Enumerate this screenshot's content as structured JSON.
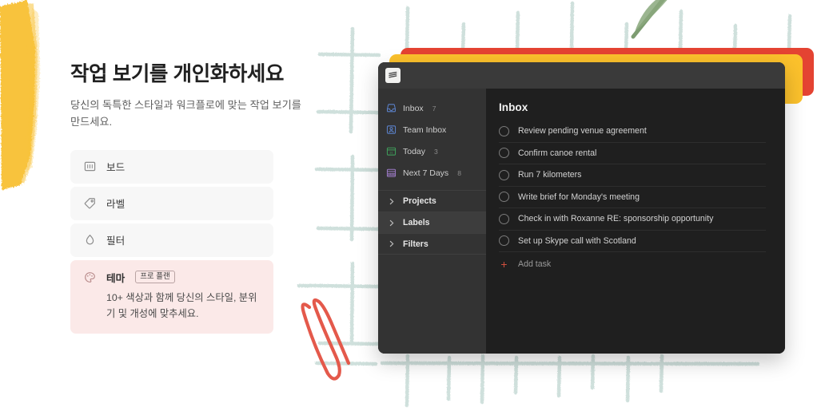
{
  "hero": {
    "headline": "작업 보기를 개인화하세요",
    "subhead": "당신의 독특한 스타일과 워크플로에 맞는 작업 보기를 만드세요."
  },
  "features": [
    {
      "icon": "board-icon",
      "label": "보드"
    },
    {
      "icon": "label-tag-icon",
      "label": "라벨"
    },
    {
      "icon": "filter-droplet-icon",
      "label": "필터"
    }
  ],
  "theme_card": {
    "icon": "palette-icon",
    "title": "테마",
    "badge": "프로 플랜",
    "description": "10+ 색상과 함께 당신의 스타일, 분위기 및 개성에 맞추세요."
  },
  "app": {
    "logo_icon": "todoist-logo-icon",
    "sidebar": {
      "items": [
        {
          "icon": "inbox-icon",
          "label": "Inbox",
          "count": "7"
        },
        {
          "icon": "team-inbox-icon",
          "label": "Team Inbox",
          "count": ""
        },
        {
          "icon": "today-calendar-icon",
          "label": "Today",
          "count": "3"
        },
        {
          "icon": "next-7-days-icon",
          "label": "Next 7 Days",
          "count": "8"
        }
      ],
      "groups": [
        {
          "icon": "chevron-right-icon",
          "label": "Projects",
          "hovered": false
        },
        {
          "icon": "chevron-right-icon",
          "label": "Labels",
          "hovered": true
        },
        {
          "icon": "chevron-right-icon",
          "label": "Filters",
          "hovered": false
        }
      ]
    },
    "main": {
      "title": "Inbox",
      "tasks": [
        "Review pending venue agreement",
        "Confirm canoe rental",
        "Run 7 kilometers",
        "Write brief for Monday's meeting",
        "Check in with Roxanne RE: sponsorship opportunity",
        "Set up Skype call with Scotland"
      ],
      "add_task_label": "Add task",
      "add_task_icon": "plus-icon"
    }
  },
  "colors": {
    "brand_red": "#e44332",
    "brand_yellow": "#fbc12c",
    "theme_card_bg": "#fbe9e8",
    "grid_teal": "#cfe0dc",
    "paperclip_red": "#e4594b",
    "stem_green": "#7a9a6e",
    "window_dark": "#1f1f1f",
    "sidebar_dark": "#333333"
  },
  "decor": {
    "brush_stroke": "yellow-brush-stroke",
    "grid": "hand-drawn-grid",
    "paperclip": "paperclip-doodle",
    "stem": "plant-stem-doodle"
  }
}
